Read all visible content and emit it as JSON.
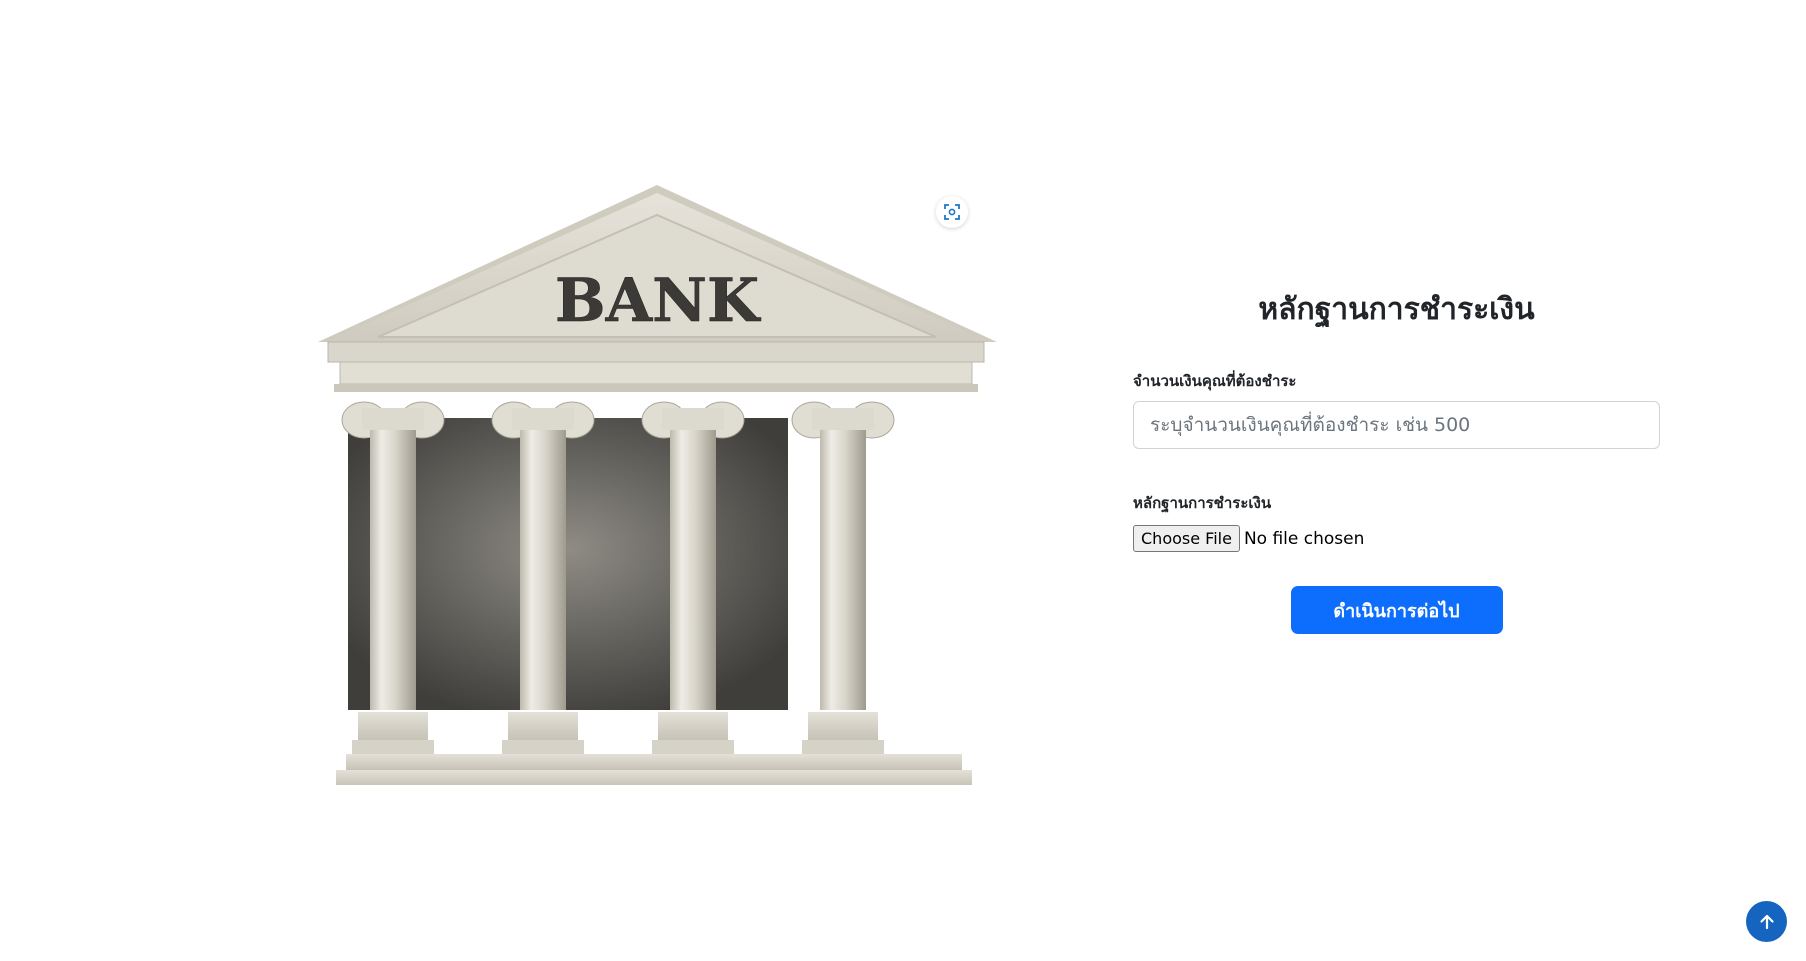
{
  "illustration": {
    "sign_text": "BANK"
  },
  "form": {
    "title": "หลักฐานการชำระเงิน",
    "amount_label": "จำนวนเงินคุณที่ต้องชำระ",
    "amount_placeholder": "ระบุจำนวนเงินคุณที่ต้องชำระ เช่น 500",
    "amount_value": "",
    "proof_label": "หลักฐานการชำระเงิน",
    "file_button_label": "Choose File",
    "file_status": "No file chosen",
    "submit_label": "ดำเนินการต่อไป"
  },
  "icons": {
    "scan": "scan-focus-icon",
    "scroll_top": "arrow-up-icon"
  },
  "colors": {
    "primary": "#0d6efd",
    "scroll_top_bg": "#1565c0",
    "scan_icon": "#1e78c8"
  }
}
